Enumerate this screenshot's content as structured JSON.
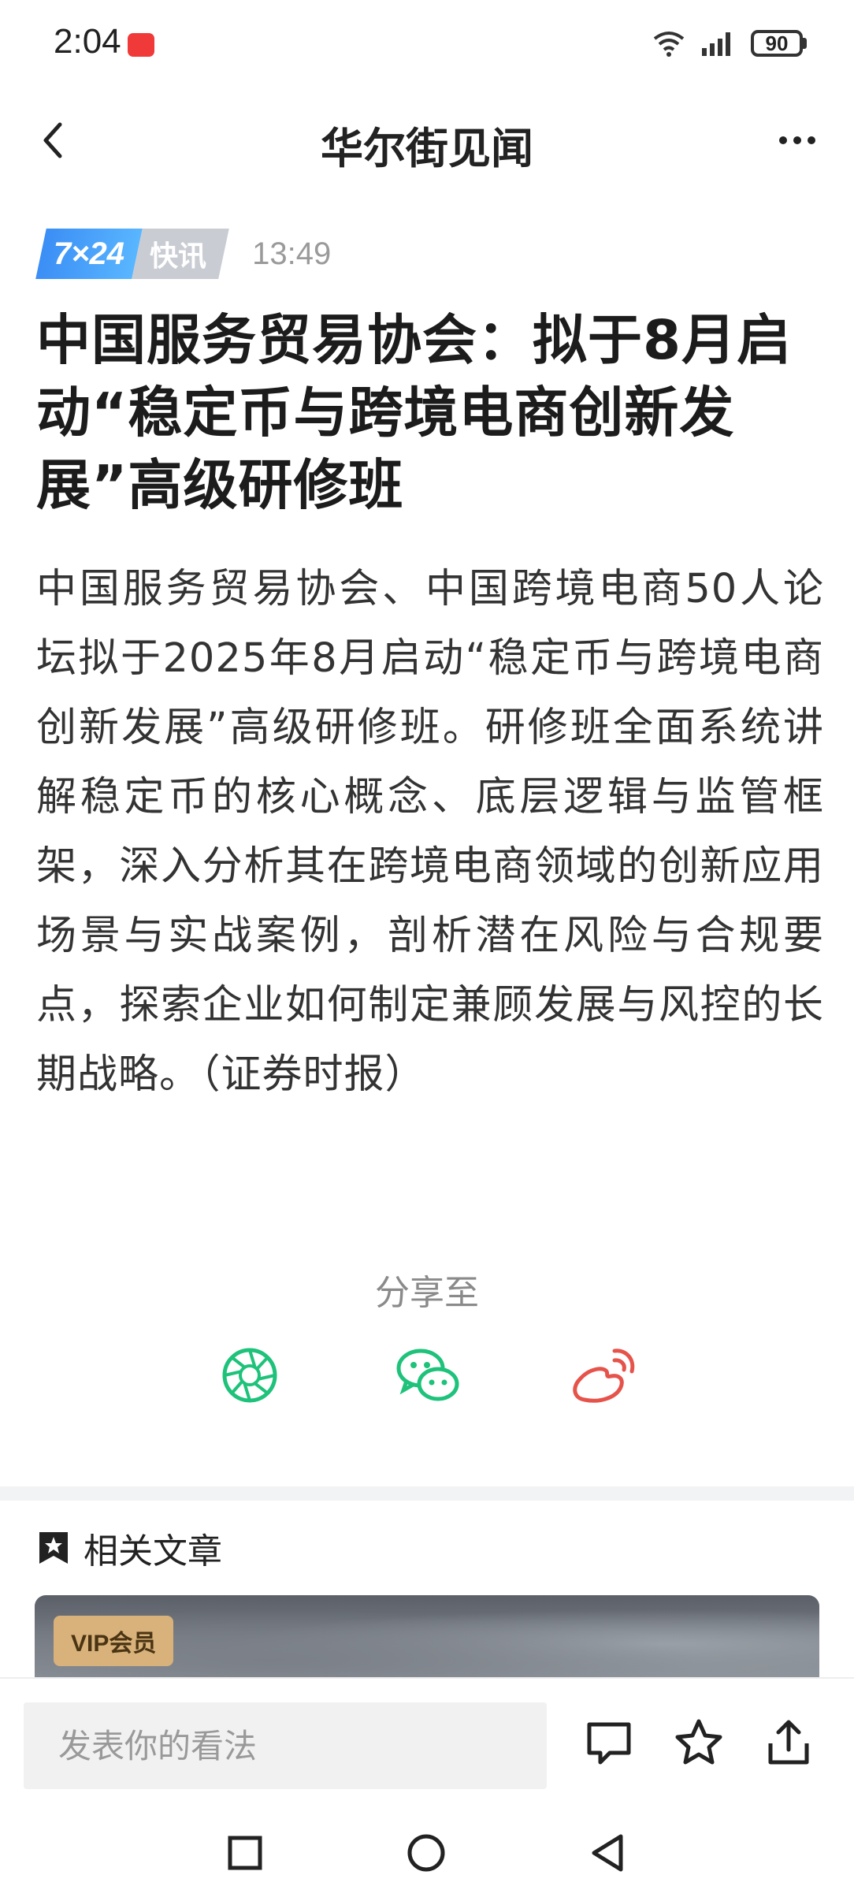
{
  "status_bar": {
    "time": "2:04",
    "battery": "90"
  },
  "nav": {
    "title": "华尔街见闻"
  },
  "article": {
    "badge_724": "7×24",
    "badge_flash": "快讯",
    "time": "13:49",
    "title": "中国服务贸易协会：拟于8月启动“稳定币与跨境电商创新发展”高级研修班",
    "body": "中国服务贸易协会、中国跨境电商50人论坛拟于2025年8月启动“稳定币与跨境电商创新发展”高级研修班。研修班全面系统讲解稳定币的核心概念、底层逻辑与监管框架，深入分析其在跨境电商领域的创新应用场景与实战案例，剖析潜在风险与合规要点，探索企业如何制定兼顾发展与风控的长期战略。（证券时报）"
  },
  "share": {
    "label": "分享至",
    "targets": [
      "moments-icon",
      "wechat-icon",
      "weibo-icon"
    ],
    "colors": {
      "green": "#1ec27a",
      "weibo": "#e5534b"
    }
  },
  "related": {
    "title": "相关文章",
    "card_badge": "VIP会员"
  },
  "comment_bar": {
    "placeholder": "发表你的看法"
  }
}
